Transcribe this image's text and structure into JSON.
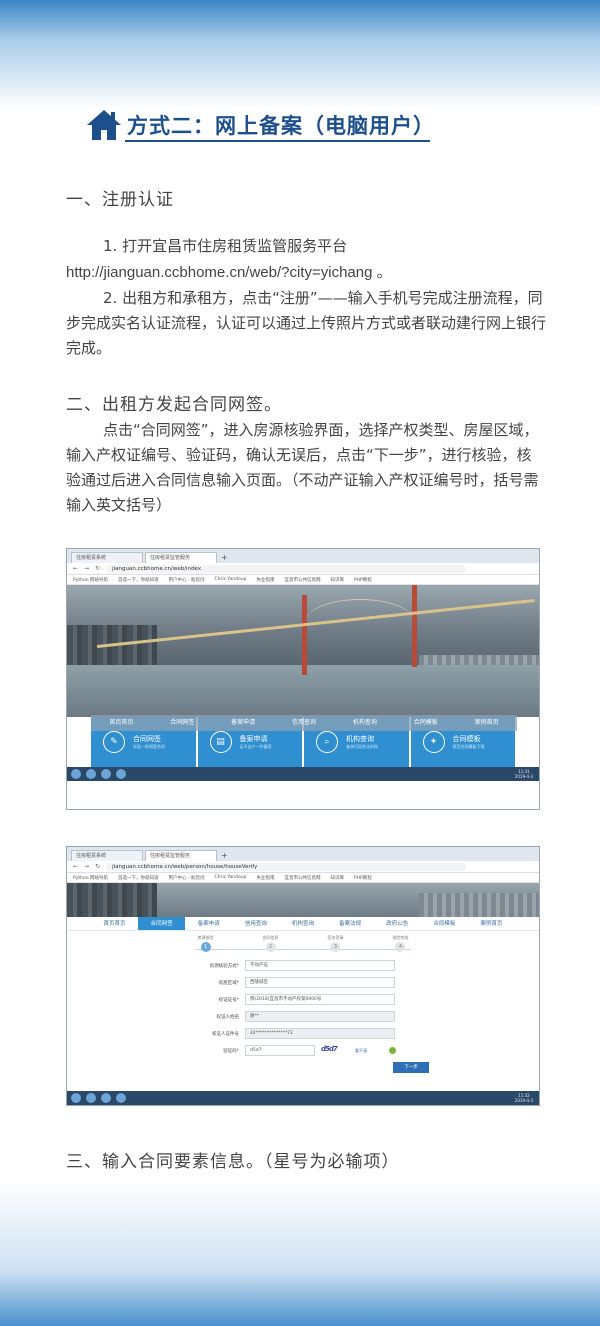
{
  "title": "方式二：网上备案（电脑用户）",
  "section1": {
    "heading": "一、注册认证",
    "p1": "1. 打开宜昌市住房租赁监管服务平台",
    "url": "http://jianguan.ccbhome.cn/web/?city=yichang 。",
    "p2": "2. 出租方和承租方，点击“注册”——输入手机号完成注册流程，同步完成实名认证流程，认证可以通过上传照片方式或者联动建行网上银行完成。"
  },
  "section2": {
    "heading": "二、出租方发起合同网签。",
    "p1": "点击“合同网签”，进入房源核验界面，选择产权类型、房屋区域，输入产权证编号、验证码，确认无误后，点击“下一步”，进行核验，核验通过后进入合同信息输入页面。（不动产证输入产权证编号时，括号需输入英文括号）"
  },
  "section3": {
    "heading": "三、输入合同要素信息。（星号为必输项）"
  },
  "shot1": {
    "tabs": [
      "住房租赁系统",
      "住房租赁监管服务"
    ],
    "url": "jianguan.ccbhome.cn/web/index",
    "bookmarks": [
      "Python 网站导航",
      "首选一下，你就知道",
      "用户中心 - 助您创",
      "Chris Yandoup",
      "失业指南",
      "宜昌市公共信息网",
      "知识库",
      "PHP教程"
    ],
    "menu": [
      "首页首页",
      "合同网签",
      "备案申请",
      "信用查询",
      "机构查询",
      "合同模板",
      "案例首页"
    ],
    "tiles": [
      {
        "title": "合同网签",
        "sub": "实现一秒网签合同",
        "icon": "✎"
      },
      {
        "title": "备案申请",
        "sub": "足不出户一秒备案",
        "icon": "▤"
      },
      {
        "title": "机构查询",
        "sub": "查询可用合法机构",
        "icon": "⌕"
      },
      {
        "title": "合同模板",
        "sub": "规范合同模板下载",
        "icon": "✦"
      }
    ],
    "clock_time": "11:31",
    "clock_date": "2019-4-3"
  },
  "shot2": {
    "tabs": [
      "住房租赁系统",
      "住房租赁监管服务"
    ],
    "url": "jianguan.ccbhome.cn/web/person/house/houseVerify",
    "menu": [
      "首页首页",
      "合同网签",
      "备案申请",
      "信用查询",
      "机构查询",
      "备案法规",
      "政府公告",
      "合同模板",
      "案例首页"
    ],
    "steps": [
      "房源核验",
      "合同信息",
      "签名签章",
      "核验完成"
    ],
    "form": [
      {
        "k": "房源核验方式*",
        "v": "不动产证"
      },
      {
        "k": "房屋区域*",
        "v": "西陵城区"
      },
      {
        "k": "权证证号*",
        "v": "鄂(2018)宜昌市不动产权第0000号"
      },
      {
        "k": "权证人姓名",
        "v": "谢**"
      },
      {
        "k": "权证人证件号",
        "v": "42**************72"
      }
    ],
    "captcha_label": "验证码*",
    "captcha_value": "d5d7",
    "captcha_img": "d5d7",
    "captcha_change": "看不清",
    "next": "下一步",
    "clock_time": "11:32",
    "clock_date": "2019-4-3"
  }
}
